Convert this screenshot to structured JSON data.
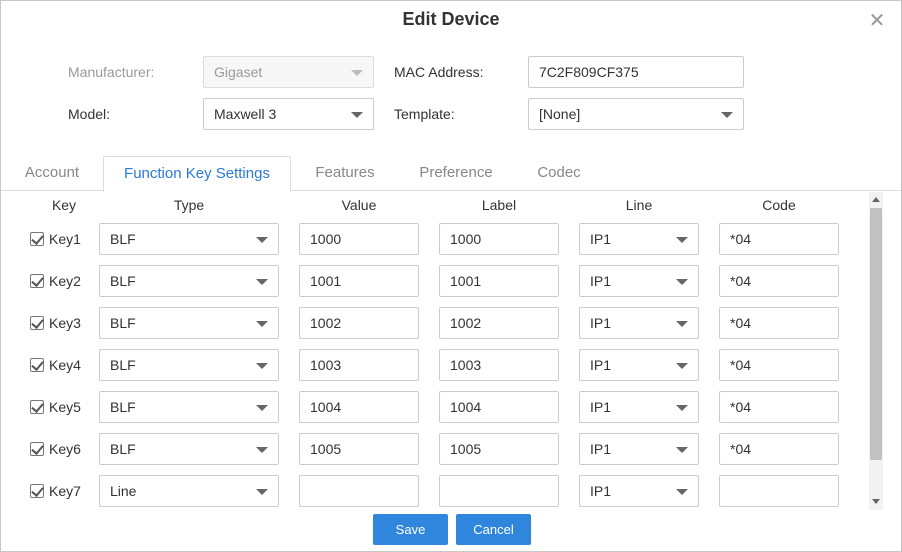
{
  "dialog": {
    "title": "Edit Device",
    "close_icon": "close-icon"
  },
  "form": {
    "manufacturer_label": "Manufacturer:",
    "manufacturer_value": "Gigaset",
    "mac_label": "MAC Address:",
    "mac_value": "7C2F809CF375",
    "model_label": "Model:",
    "model_value": "Maxwell 3",
    "template_label": "Template:",
    "template_value": "[None]"
  },
  "tabs": [
    {
      "label": "Account"
    },
    {
      "label": "Function Key Settings"
    },
    {
      "label": "Features"
    },
    {
      "label": "Preference"
    },
    {
      "label": "Codec"
    }
  ],
  "active_tab": "Function Key Settings",
  "table": {
    "headers": [
      "Key",
      "Type",
      "Value",
      "Label",
      "Line",
      "Code"
    ],
    "rows": [
      {
        "key": "Key1",
        "checked": true,
        "type": "BLF",
        "value": "1000",
        "label": "1000",
        "line": "IP1",
        "code": "*04"
      },
      {
        "key": "Key2",
        "checked": true,
        "type": "BLF",
        "value": "1001",
        "label": "1001",
        "line": "IP1",
        "code": "*04"
      },
      {
        "key": "Key3",
        "checked": true,
        "type": "BLF",
        "value": "1002",
        "label": "1002",
        "line": "IP1",
        "code": "*04"
      },
      {
        "key": "Key4",
        "checked": true,
        "type": "BLF",
        "value": "1003",
        "label": "1003",
        "line": "IP1",
        "code": "*04"
      },
      {
        "key": "Key5",
        "checked": true,
        "type": "BLF",
        "value": "1004",
        "label": "1004",
        "line": "IP1",
        "code": "*04"
      },
      {
        "key": "Key6",
        "checked": true,
        "type": "BLF",
        "value": "1005",
        "label": "1005",
        "line": "IP1",
        "code": "*04"
      },
      {
        "key": "Key7",
        "checked": true,
        "type": "Line",
        "value": "",
        "label": "",
        "line": "IP1",
        "code": ""
      }
    ]
  },
  "buttons": {
    "save_label": "Save",
    "cancel_label": "Cancel"
  },
  "colors": {
    "accent": "#2f86dc",
    "active_tab_text": "#2a7ad4"
  }
}
